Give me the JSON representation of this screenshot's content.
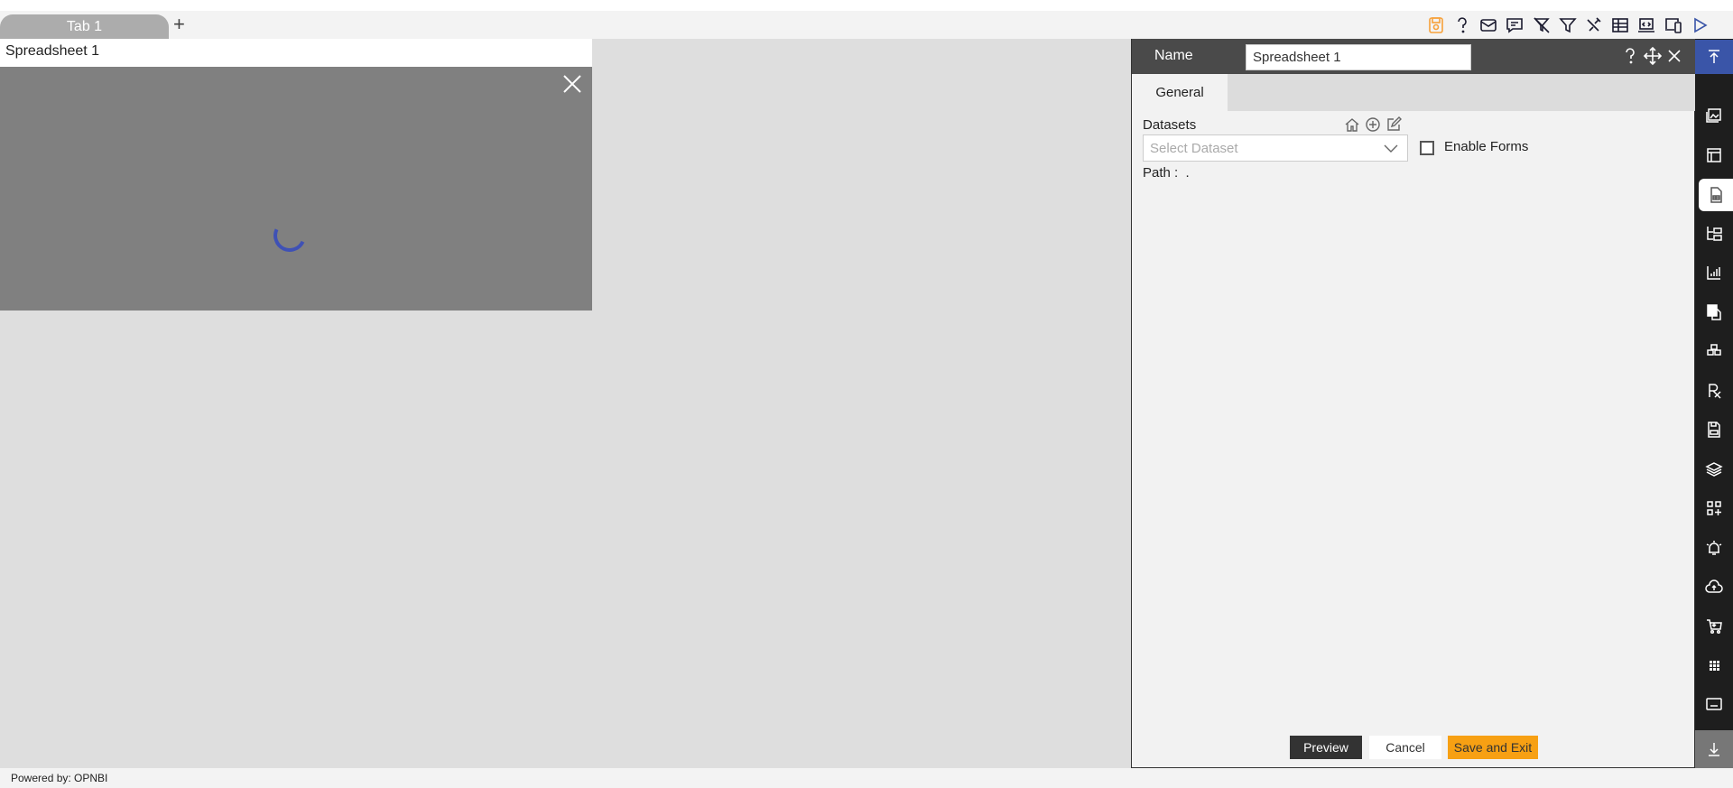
{
  "tabs": [
    {
      "label": "Tab 1"
    }
  ],
  "add_tab_label": "+",
  "toolbar": {
    "icons": [
      "save-icon",
      "help-icon",
      "email-icon",
      "comment-icon",
      "clear-filter-icon",
      "filter-icon",
      "tools-icon",
      "table-icon",
      "embed-icon",
      "devices-icon",
      "play-icon"
    ],
    "save_color": "#f7a13a"
  },
  "widget": {
    "title": "Spreadsheet 1",
    "loading": true
  },
  "panel": {
    "name_label": "Name",
    "name_value": "Spreadsheet 1",
    "tabs": [
      "General"
    ],
    "datasets_label": "Datasets",
    "dataset_placeholder": "Select Dataset",
    "enable_forms_label": "Enable Forms",
    "enable_forms_checked": false,
    "path_label": "Path :",
    "path_value": ".",
    "buttons": {
      "preview": "Preview",
      "cancel": "Cancel",
      "save_exit": "Save and Exit"
    }
  },
  "sidebar": {
    "icons": [
      "scroll-top-icon",
      "image-icon",
      "layout-icon",
      "spreadsheet-icon",
      "folder-tree-icon",
      "chart-icon",
      "copy-icon",
      "cubes-icon",
      "rx-icon",
      "save-file-icon",
      "layers-icon",
      "add-widget-icon",
      "alert-icon",
      "cloud-upload-icon",
      "cart-icon",
      "grid-icon",
      "caption-icon",
      "scroll-bottom-icon"
    ],
    "selected": "spreadsheet-icon",
    "accent": "#3a55a8"
  },
  "footer": {
    "text": "Powered by: OPNBI"
  }
}
